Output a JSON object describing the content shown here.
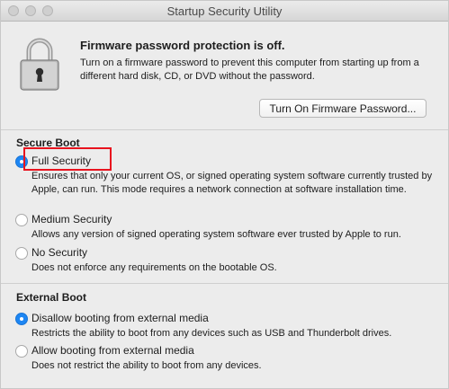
{
  "window": {
    "title": "Startup Security Utility"
  },
  "firmware": {
    "heading": "Firmware password protection is off.",
    "description": "Turn on a firmware password to prevent this computer from starting up from a different hard disk, CD, or DVD without the password.",
    "button_label": "Turn On Firmware Password..."
  },
  "secure_boot": {
    "heading": "Secure Boot",
    "options": [
      {
        "label": "Full Security",
        "selected": true,
        "description": "Ensures that only your current OS, or signed operating system software currently trusted by Apple, can run. This mode requires a network connection at software installation time."
      },
      {
        "label": "Medium Security",
        "selected": false,
        "description": "Allows any version of signed operating system software ever trusted by Apple to run."
      },
      {
        "label": "No Security",
        "selected": false,
        "description": "Does not enforce any requirements on the bootable OS."
      }
    ]
  },
  "external_boot": {
    "heading": "External Boot",
    "options": [
      {
        "label": "Disallow booting from external media",
        "selected": true,
        "description": "Restricts the ability to boot from any devices such as USB and Thunderbolt drives."
      },
      {
        "label": "Allow booting from external media",
        "selected": false,
        "description": "Does not restrict the ability to boot from any devices."
      }
    ]
  },
  "colors": {
    "accent": "#1d86f3",
    "highlight": "#e8131e"
  },
  "icons": {
    "lock": "lock-icon"
  }
}
